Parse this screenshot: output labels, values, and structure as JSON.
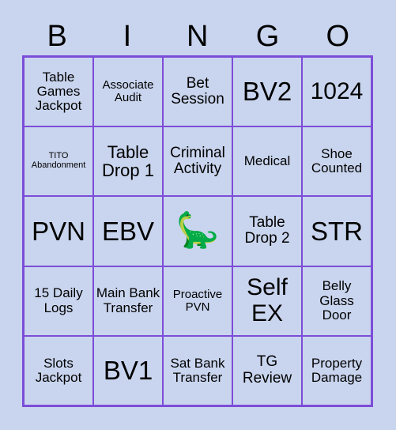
{
  "card": {
    "title": "BINGO",
    "header_letters": [
      "B",
      "I",
      "N",
      "G",
      "O"
    ],
    "colors": {
      "background": "#c9d5ee",
      "border": "#7c4dd8",
      "cell_background": "#c9d5ee",
      "text": "#000000"
    },
    "rows": [
      [
        {
          "label": "Table Games Jackpot",
          "size": "md",
          "free": false
        },
        {
          "label": "Associate Audit",
          "size": "sm",
          "free": false
        },
        {
          "label": "Bet Session",
          "size": "lg",
          "free": false
        },
        {
          "label": "BV2",
          "size": "huge",
          "free": false
        },
        {
          "label": "1024",
          "size": "xxl",
          "free": false
        }
      ],
      [
        {
          "label": "TITO Abandonment",
          "size": "xs",
          "free": false
        },
        {
          "label": "Table Drop 1",
          "size": "xl",
          "free": false
        },
        {
          "label": "Criminal Activity",
          "size": "lg",
          "free": false
        },
        {
          "label": "Medical",
          "size": "md",
          "free": false
        },
        {
          "label": "Shoe Counted",
          "size": "md",
          "free": false
        }
      ],
      [
        {
          "label": "PVN",
          "size": "huge",
          "free": false
        },
        {
          "label": "EBV",
          "size": "huge",
          "free": false
        },
        {
          "label": "🦕",
          "size": "free",
          "free": true
        },
        {
          "label": "Table Drop 2",
          "size": "lg",
          "free": false
        },
        {
          "label": "STR",
          "size": "huge",
          "free": false
        }
      ],
      [
        {
          "label": "15 Daily Logs",
          "size": "md",
          "free": false
        },
        {
          "label": "Main Bank Transfer",
          "size": "md",
          "free": false
        },
        {
          "label": "Proactive PVN",
          "size": "sm",
          "free": false
        },
        {
          "label": "Self EX",
          "size": "xxl",
          "free": false
        },
        {
          "label": "Belly Glass Door",
          "size": "md",
          "free": false
        }
      ],
      [
        {
          "label": "Slots Jackpot",
          "size": "md",
          "free": false
        },
        {
          "label": "BV1",
          "size": "huge",
          "free": false
        },
        {
          "label": "Sat Bank Transfer",
          "size": "md",
          "free": false
        },
        {
          "label": "TG Review",
          "size": "lg",
          "free": false
        },
        {
          "label": "Property Damage",
          "size": "md",
          "free": false
        }
      ]
    ],
    "free_space": {
      "icon_name": "dinosaur-icon",
      "glyph": "🦕"
    }
  }
}
